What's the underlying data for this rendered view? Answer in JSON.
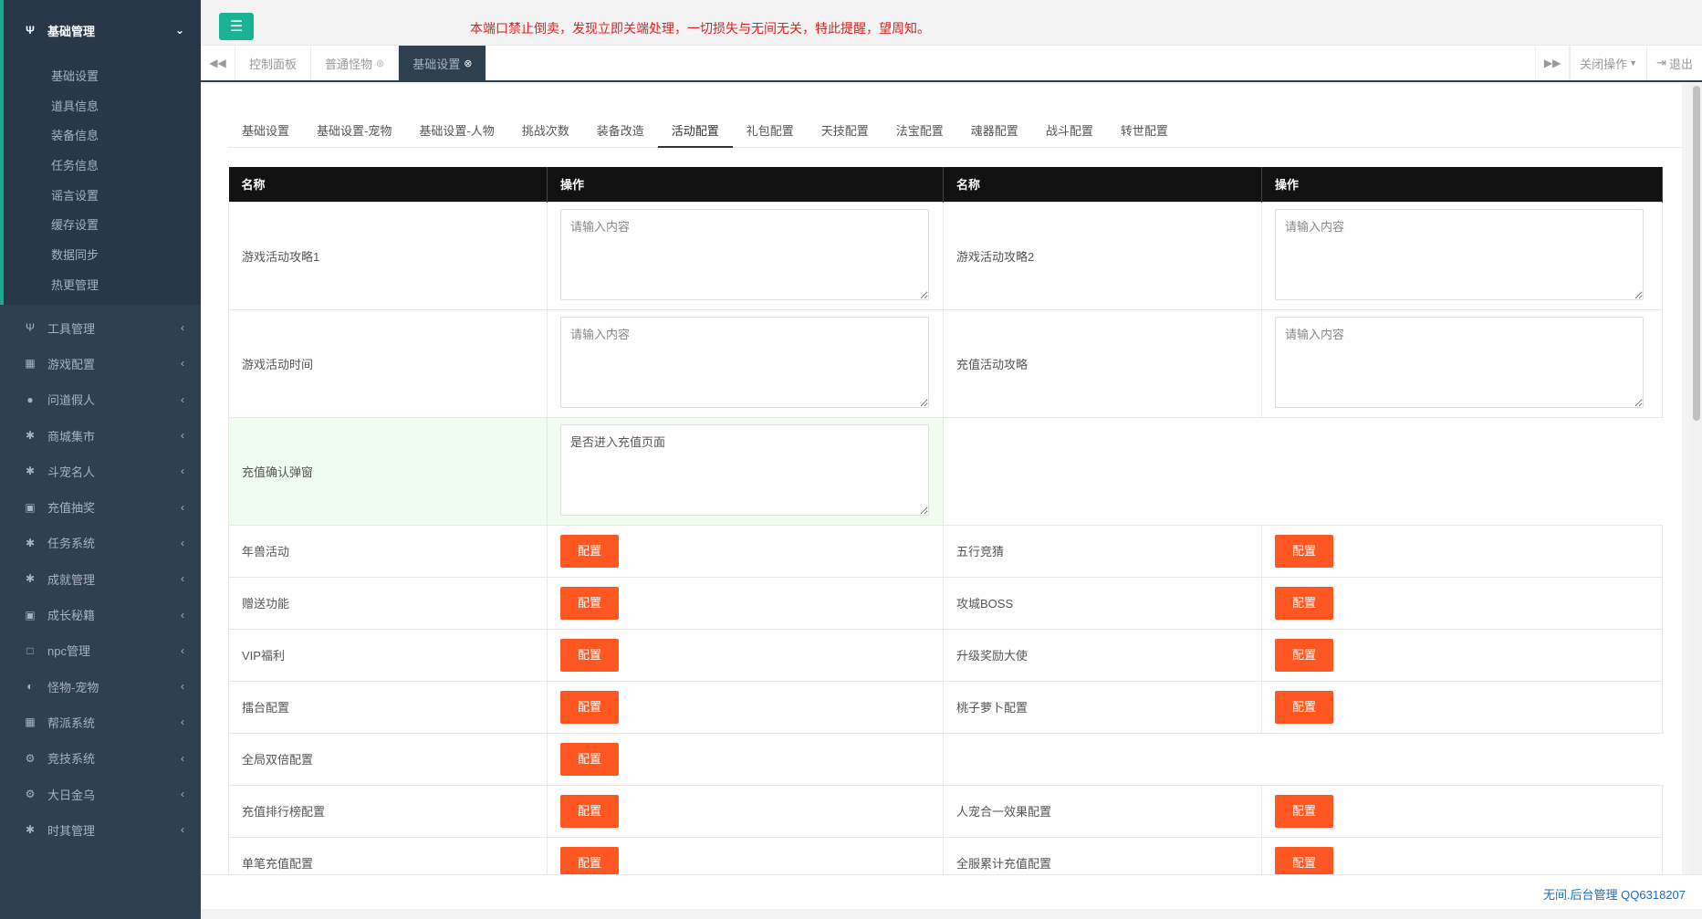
{
  "sidebar": {
    "active_group": {
      "label": "基础管理",
      "icon": "cutlery-icon"
    },
    "sub_items": [
      "基础设置",
      "道具信息",
      "装备信息",
      "任务信息",
      "谣言设置",
      "缓存设置",
      "数据同步",
      "热更管理"
    ],
    "groups": [
      {
        "label": "工具管理",
        "icon": "cutlery-icon",
        "glyph": "Ψ"
      },
      {
        "label": "游戏配置",
        "icon": "table-icon",
        "glyph": "▦"
      },
      {
        "label": "问道假人",
        "icon": "user-icon",
        "glyph": "●"
      },
      {
        "label": "商城集市",
        "icon": "gear-icon",
        "glyph": "✱"
      },
      {
        "label": "斗宠名人",
        "icon": "gear-icon",
        "glyph": "✱"
      },
      {
        "label": "充值抽奖",
        "icon": "money-icon",
        "glyph": "▣"
      },
      {
        "label": "任务系统",
        "icon": "gear-icon",
        "glyph": "✱"
      },
      {
        "label": "成就管理",
        "icon": "gear-icon",
        "glyph": "✱"
      },
      {
        "label": "成长秘籍",
        "icon": "money-icon",
        "glyph": "▣"
      },
      {
        "label": "npc管理",
        "icon": "square-icon",
        "glyph": "□"
      },
      {
        "label": "怪物-宠物",
        "icon": "adjust-icon",
        "glyph": "◐"
      },
      {
        "label": "帮派系统",
        "icon": "table-icon",
        "glyph": "▦"
      },
      {
        "label": "竞技系统",
        "icon": "gears-icon",
        "glyph": "⚙"
      },
      {
        "label": "大日金乌",
        "icon": "gears-icon",
        "glyph": "⚙"
      },
      {
        "label": "时其管理",
        "icon": "gear-icon",
        "glyph": "✱"
      }
    ]
  },
  "header": {
    "notice": "本端口禁止倒卖，发现立即关端处理，一切损失与无间无关，特此提醒，望周知。"
  },
  "tabs": {
    "items": [
      {
        "label": "控制面板",
        "closable": false,
        "active": false
      },
      {
        "label": "普通怪物",
        "closable": true,
        "active": false
      },
      {
        "label": "基础设置",
        "closable": true,
        "active": true
      }
    ],
    "close_ops": "关闭操作",
    "logout": "退出"
  },
  "subtabs": [
    "基础设置",
    "基础设置-宠物",
    "基础设置-人物",
    "挑战次数",
    "装备改造",
    "活动配置",
    "礼包配置",
    "天技配置",
    "法宝配置",
    "魂器配置",
    "战斗配置",
    "转世配置"
  ],
  "subtabs_active": "活动配置",
  "table": {
    "headers": [
      "名称",
      "操作",
      "名称",
      "操作"
    ],
    "placeholder": "请输入内容",
    "text_rows": [
      {
        "left": "游戏活动攻略1",
        "right": "游戏活动攻略2"
      },
      {
        "left": "游戏活动时间",
        "right": "充值活动攻略"
      }
    ],
    "highlight_row": {
      "label": "充值确认弹窗",
      "value": "是否进入充值页面"
    },
    "button_label": "配置",
    "button_rows": [
      {
        "left": "年兽活动",
        "right": "五行竞猜"
      },
      {
        "left": "赠送功能",
        "right": "攻城BOSS"
      },
      {
        "left": "VIP福利",
        "right": "升级奖励大使"
      },
      {
        "left": "擂台配置",
        "right": "桃子萝卜配置"
      },
      {
        "left": "全局双倍配置",
        "right": null
      },
      {
        "left": "充值排行榜配置",
        "right": "人宠合一效果配置"
      },
      {
        "left": "单笔充值配置",
        "right": "全服累计充值配置"
      }
    ]
  },
  "footer": {
    "text": "无间.后台管理 QQ6318207"
  },
  "colors": {
    "sidebar": "#2f4050",
    "accent": "#1ab394",
    "button": "#ff5722",
    "notice": "#e02020",
    "footer_text": "#1e6bb8"
  }
}
